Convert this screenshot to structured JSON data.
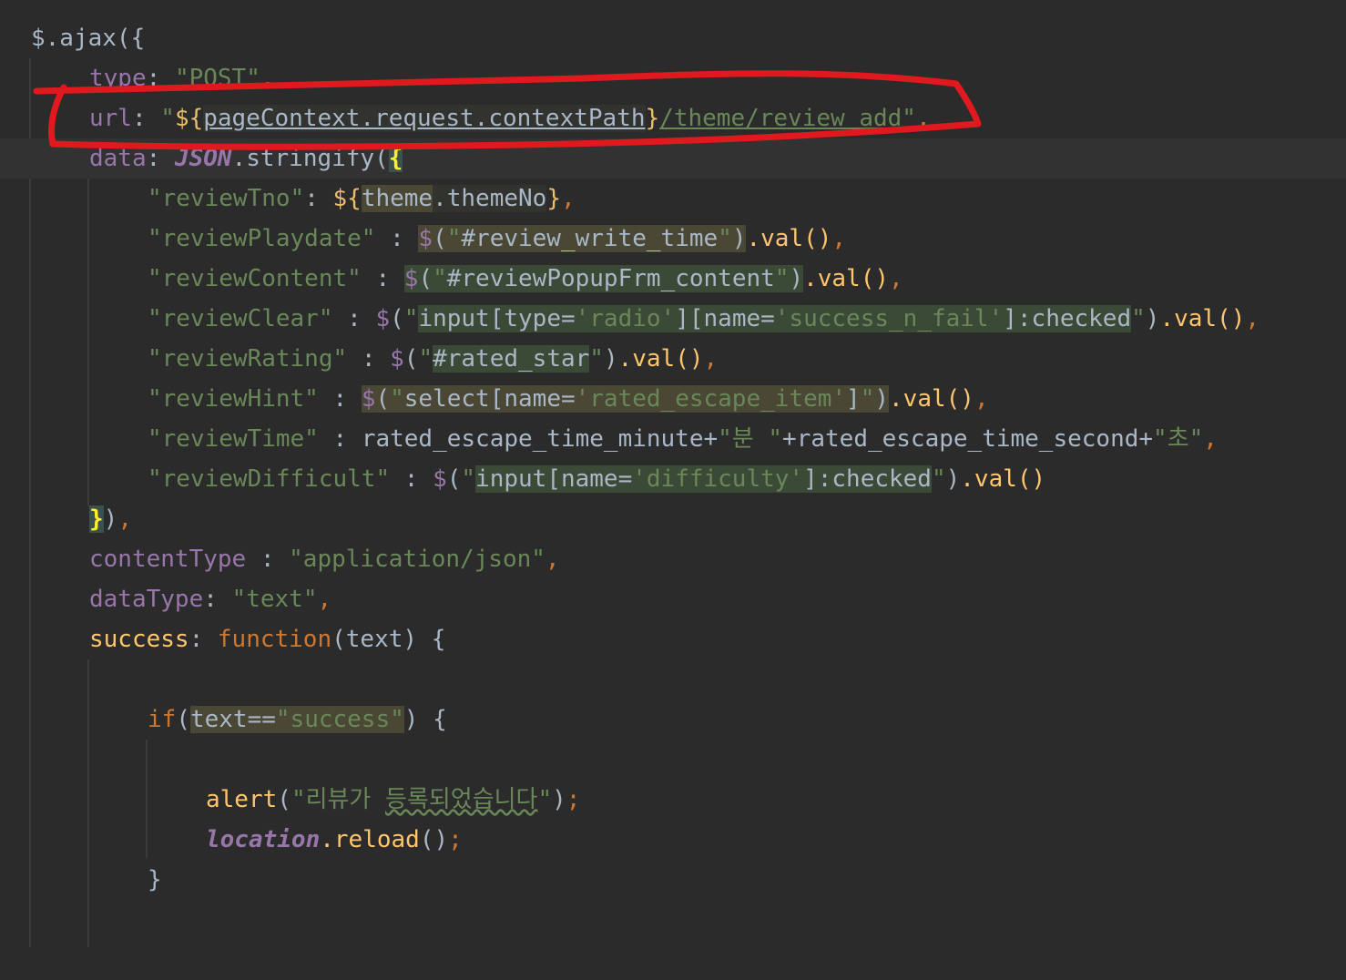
{
  "lines": {
    "l1": "$.ajax({",
    "l2_key": "type",
    "l2_val": "\"POST\"",
    "l3_key": "url",
    "l3_q1": "\"",
    "l3_el_open": "${",
    "l3_el_body": "pageContext.request.contextPath",
    "l3_el_close": "}",
    "l3_path": "/theme/review_add",
    "l3_q2": "\"",
    "l4_key": "data",
    "l4_json": "JSON",
    "l4_fn": ".stringify(",
    "l4_brace": "{",
    "l5_key": "\"reviewTno\"",
    "l5_el_open": "${",
    "l5_theme": "theme",
    "l5_rest": ".themeNo",
    "l5_el_close": "}",
    "l6_key": "\"reviewPlaydate\"",
    "l6_sel": "#review_write_time",
    "l7_key": "\"reviewContent\"",
    "l7_sel": "#reviewPopupFrm_content",
    "l8_key": "\"reviewClear\"",
    "l8_sel_a": "input[type=",
    "l8_sel_b": "'radio'",
    "l8_sel_c": "][name=",
    "l8_sel_d": "'success_n_fail'",
    "l8_sel_e": "]:checked",
    "l9_key": "\"reviewRating\"",
    "l9_sel": "#rated_star",
    "l10_key": "\"reviewHint\"",
    "l10_sel_a": "select[name=",
    "l10_sel_b": "'rated_escape_item'",
    "l10_sel_c": "]",
    "l11_key": "\"reviewTime\"",
    "l11_a": "rated_escape_time_minute+",
    "l11_b": "\"분 \"",
    "l11_c": "+rated_escape_time_second+",
    "l11_d": "\"초\"",
    "l12_key": "\"reviewDifficult\"",
    "l12_sel_a": "input[name=",
    "l12_sel_b": "'difficulty'",
    "l12_sel_c": "]:checked",
    "l13": "}",
    "l14_key": "contentType",
    "l14_val": "\"application/json\"",
    "l15_key": "dataType",
    "l15_val": "\"text\"",
    "l16_key": "success",
    "l16_fn": "function",
    "l16_param": "(text) {",
    "l18_if": "if",
    "l18_a": "text==",
    "l18_b": "\"success\"",
    "l18_c": ") {",
    "l20_fn": "alert",
    "l20_str_a": "\"리뷰가 ",
    "l20_str_b": "등록되었습니다",
    "l20_str_c": "\"",
    "l21_obj": "location",
    "l21_fn": ".reload",
    "l22": "}",
    "val_call": ".val()",
    "dollar": "$",
    "comma": ",",
    "colon": ":"
  },
  "annotation": {
    "color": "#e0191f"
  }
}
